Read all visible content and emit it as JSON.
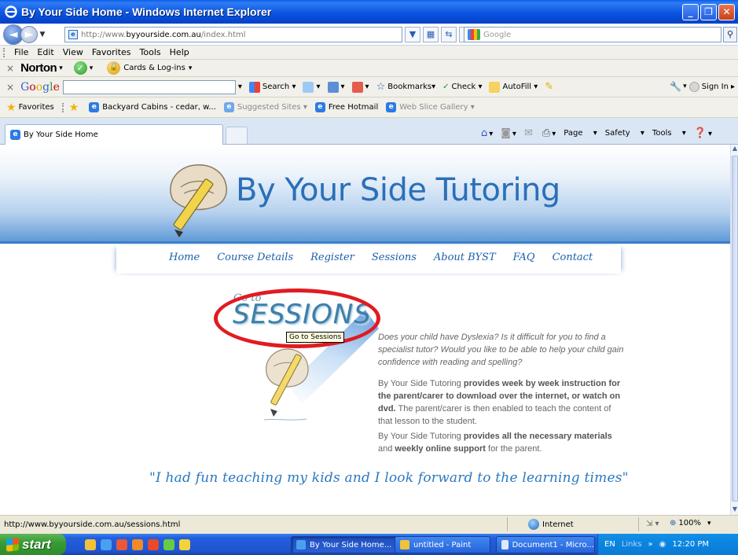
{
  "window": {
    "title": "By Your Side Home - Windows Internet Explorer",
    "min_label": "_",
    "max_label": "❐",
    "close_label": "✕"
  },
  "address": {
    "url_prefix": "http://www.",
    "url_domain": "byyourside.com.au",
    "url_path": "/index.html",
    "search_placeholder": "Google"
  },
  "menu": [
    "File",
    "Edit",
    "View",
    "Favorites",
    "Tools",
    "Help"
  ],
  "norton": {
    "brand": "Norton",
    "cards_label": "Cards & Log-ins"
  },
  "google_toolbar": {
    "search_label": "Search",
    "bookmarks_label": "Bookmarks",
    "check_label": "Check",
    "autofill_label": "AutoFill",
    "signin_label": "Sign In"
  },
  "favorites": {
    "label": "Favorites",
    "items": [
      "Backyard Cabins - cedar, w...",
      "Suggested Sites",
      "Free Hotmail",
      "Web Slice Gallery"
    ]
  },
  "tab": {
    "label": "By Your Side Home"
  },
  "commands": {
    "page_label": "Page",
    "safety_label": "Safety",
    "tools_label": "Tools"
  },
  "site": {
    "title": "By Your Side Tutoring",
    "nav": [
      "Home",
      "Course Details",
      "Register",
      "Sessions",
      "About BYST",
      "FAQ",
      "Contact"
    ],
    "goto_prefix": "Go to",
    "sessions_label": "SESSIONS",
    "tooltip": "Go to Sessions",
    "intro": "Does your child have Dyslexia? Is it difficult for you to find a specialist tutor? Would you like to be able to help your child gain confidence with reading and spelling?",
    "p2_a": "By Your Side Tutoring ",
    "p2_b": "provides week by week instruction for the parent/carer to download over the internet, or watch on dvd.",
    "p2_c": " The parent/carer is then enabled to teach the content of that lesson to the student.",
    "p3_a": "By Your Side Tutoring ",
    "p3_b": "provides all the necessary materials",
    "p3_c": " and ",
    "p3_d": "weekly online support",
    "p3_e": " for the parent.",
    "quote": "\"I had fun teaching my kids and I look forward to the learning times\""
  },
  "status": {
    "url": "http://www.byyourside.com.au/sessions.html",
    "zone": "Internet",
    "zoom": "100%"
  },
  "taskbar": {
    "start": "start",
    "items": [
      "By Your Side Home...",
      "untitled - Paint",
      "Document1 - Micro..."
    ],
    "lang": "EN",
    "links": "Links",
    "time": "12:20 PM"
  }
}
